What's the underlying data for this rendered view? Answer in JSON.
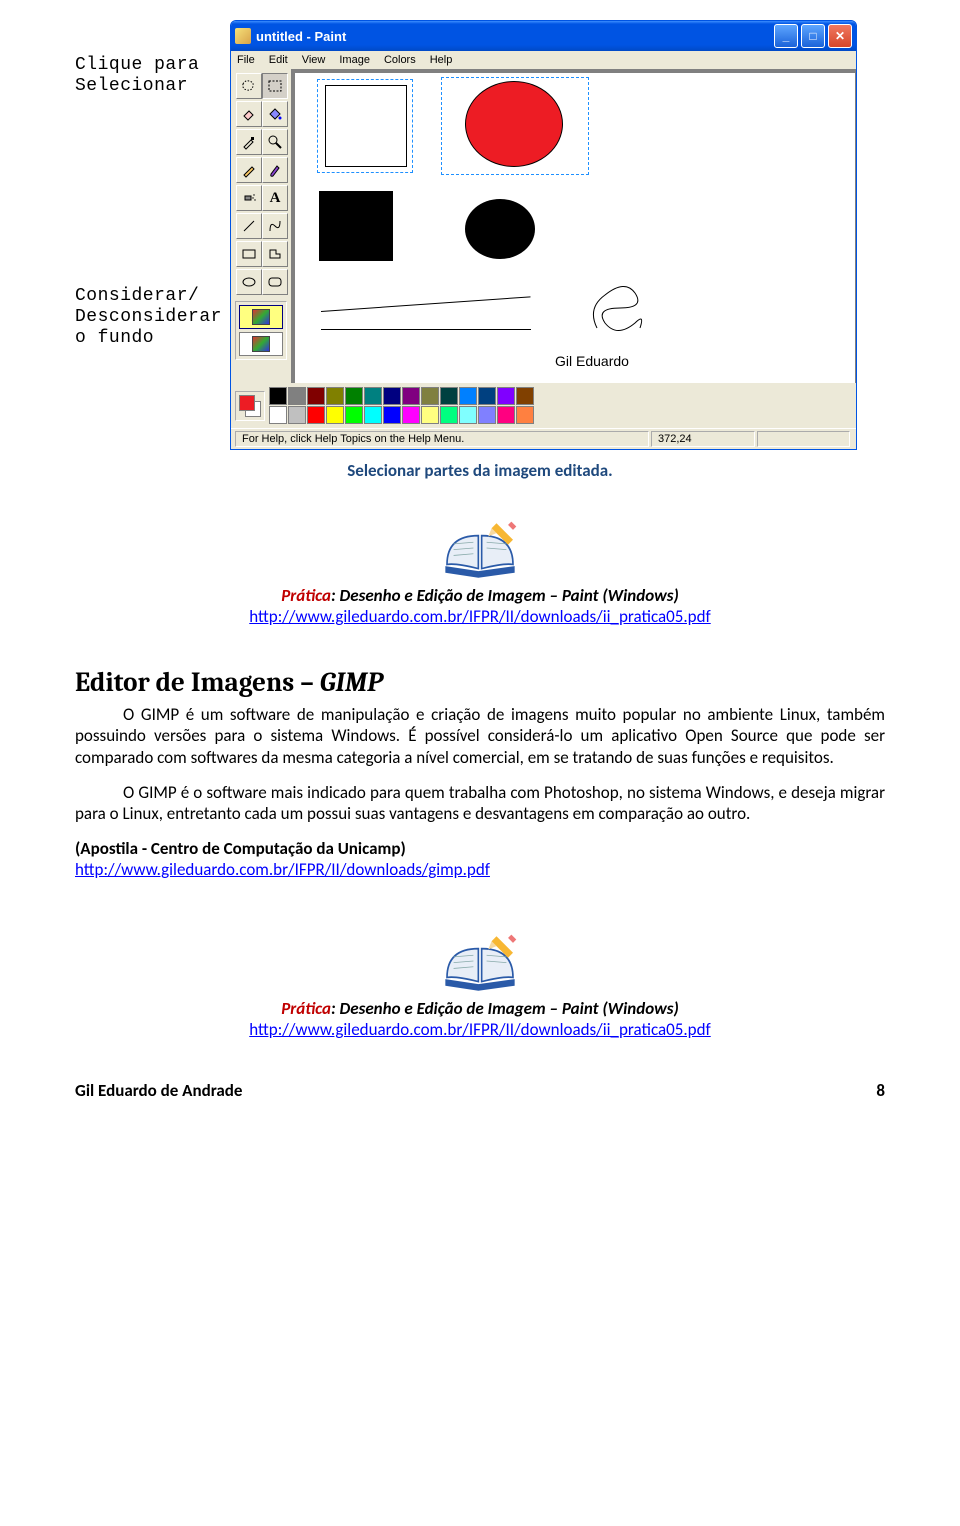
{
  "annotations": {
    "select": "Clique para\nSelecionar",
    "background": "Considerar/\nDesconsiderar\no fundo"
  },
  "paint": {
    "title": "untitled - Paint",
    "menu": [
      "File",
      "Edit",
      "View",
      "Image",
      "Colors",
      "Help"
    ],
    "canvas_text": "Gil Eduardo",
    "status_help": "For Help, click Help Topics on the Help Menu.",
    "status_coord": "372,24",
    "palette_row1": [
      "#000000",
      "#808080",
      "#800000",
      "#808000",
      "#008000",
      "#008080",
      "#000080",
      "#800080",
      "#808040",
      "#004040",
      "#0080ff",
      "#004080",
      "#8000ff",
      "#804000"
    ],
    "palette_row2": [
      "#ffffff",
      "#c0c0c0",
      "#ff0000",
      "#ffff00",
      "#00ff00",
      "#00ffff",
      "#0000ff",
      "#ff00ff",
      "#ffff80",
      "#00ff80",
      "#80ffff",
      "#8080ff",
      "#ff0080",
      "#ff8040"
    ]
  },
  "caption": "Selecionar partes da imagem editada.",
  "pratica": {
    "label": "Prática",
    "desc": ": Desenho e Edição de Imagem – Paint (Windows)",
    "url": "http://www.gileduardo.com.br/IFPR/II/downloads/ii_pratica05.pdf"
  },
  "section": {
    "title_main": "Editor de Imagens – ",
    "title_em": "GIMP",
    "p1": "O GIMP é um software de manipulação e criação de imagens muito popular no ambiente Linux, também possuindo versões para o sistema Windows. É possível considerá-lo um aplicativo Open Source que pode ser comparado com softwares da mesma categoria a nível comercial, em se tratando de suas funções e requisitos.",
    "p2": "O GIMP é o software mais indicado para quem trabalha com Photoshop, no sistema Windows, e deseja migrar para o Linux, entretanto cada um possui suas vantagens e desvantagens em comparação ao outro."
  },
  "apostila": {
    "label": "(Apostila - Centro de Computação da Unicamp)",
    "url": "http://www.gileduardo.com.br/IFPR/II/downloads/gimp.pdf"
  },
  "footer": {
    "author": "Gil Eduardo de Andrade",
    "page": "8"
  }
}
